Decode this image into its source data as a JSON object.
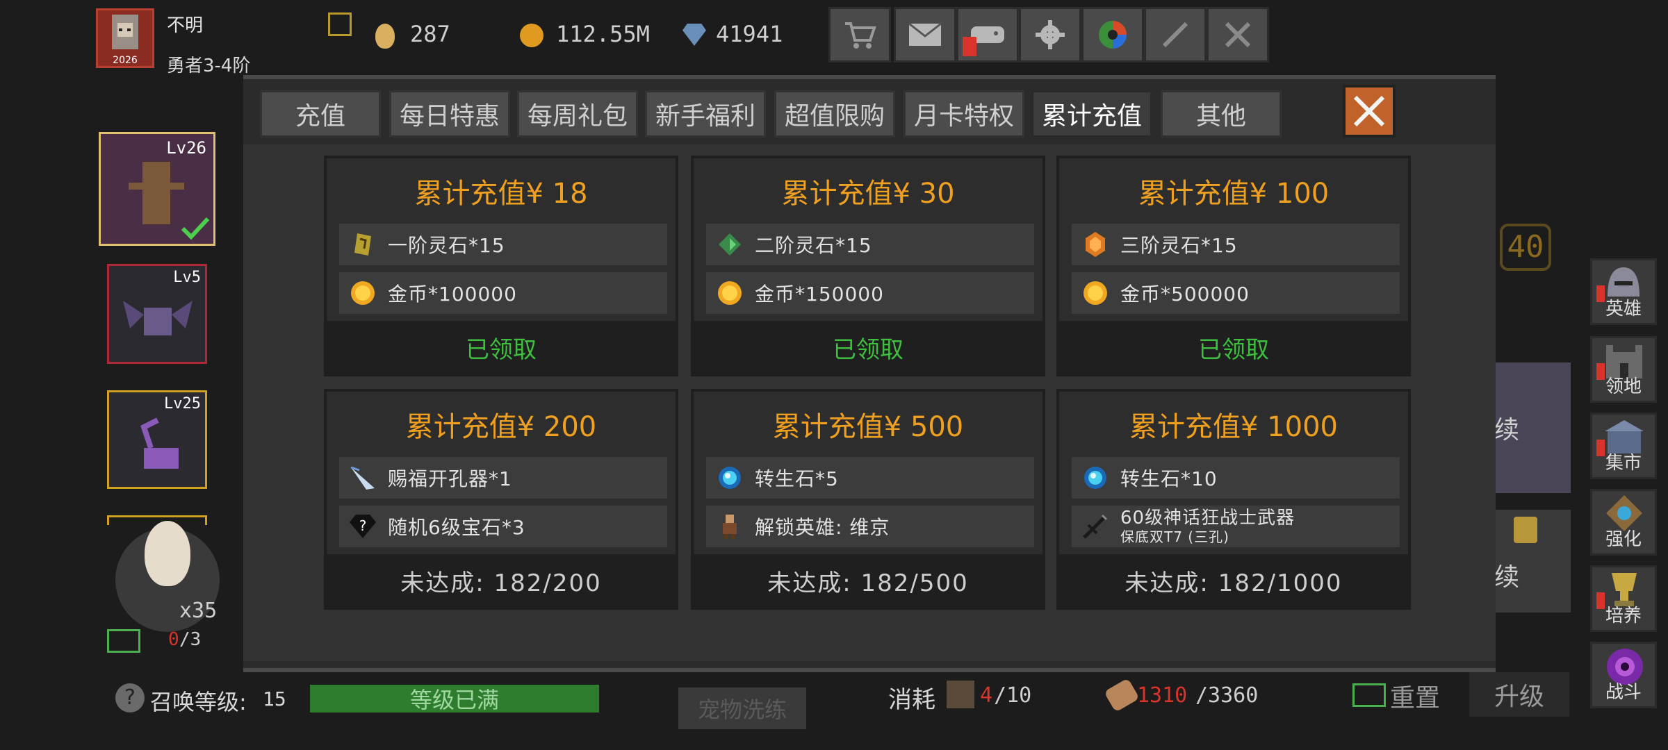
{
  "player": {
    "name": "不明",
    "rank": "勇者3-4阶",
    "avatar_year": "2026"
  },
  "resources": {
    "eggs": "287",
    "gold": "112.55M",
    "gems": "41941"
  },
  "top_icons": [
    "cart-icon",
    "mail-icon",
    "gamepad-icon",
    "gear-icon",
    "color-wheel-icon",
    "sword-locked-icon",
    "sword-crossed-icon"
  ],
  "tabs": [
    {
      "label": "充值"
    },
    {
      "label": "每日特惠"
    },
    {
      "label": "每周礼包"
    },
    {
      "label": "新手福利"
    },
    {
      "label": "超值限购"
    },
    {
      "label": "月卡特权"
    },
    {
      "label": "累计充值",
      "active": true
    },
    {
      "label": "其他"
    }
  ],
  "cards": [
    {
      "title": "累计充值¥ 18",
      "items": [
        {
          "icon": "tier1-stone-icon",
          "text": "一阶灵石*15"
        },
        {
          "icon": "gold-coin-icon",
          "text": "金币*100000"
        }
      ],
      "status": "已领取",
      "done": true
    },
    {
      "title": "累计充值¥ 30",
      "items": [
        {
          "icon": "tier2-stone-icon",
          "text": "二阶灵石*15"
        },
        {
          "icon": "gold-coin-icon",
          "text": "金币*150000"
        }
      ],
      "status": "已领取",
      "done": true
    },
    {
      "title": "累计充值¥ 100",
      "items": [
        {
          "icon": "tier3-stone-icon",
          "text": "三阶灵石*15"
        },
        {
          "icon": "gold-coin-icon",
          "text": "金币*500000"
        }
      ],
      "status": "已领取",
      "done": true
    },
    {
      "title": "累计充值¥ 200",
      "items": [
        {
          "icon": "drill-icon",
          "text": "赐福开孔器*1"
        },
        {
          "icon": "random-gem-icon",
          "text": "随机6级宝石*3"
        }
      ],
      "status": "未达成: 182/200",
      "done": false
    },
    {
      "title": "累计充值¥ 500",
      "items": [
        {
          "icon": "rebirth-stone-icon",
          "text": "转生石*5"
        },
        {
          "icon": "hero-unlock-icon",
          "text": "解锁英雄: 维京"
        }
      ],
      "status": "未达成: 182/500",
      "done": false
    },
    {
      "title": "累计充值¥ 1000",
      "items": [
        {
          "icon": "rebirth-stone-icon",
          "text": "转生石*10"
        },
        {
          "icon": "mythic-weapon-icon",
          "text": "60级神话狂战士武器",
          "subtext": "保底双T7 (三孔)"
        }
      ],
      "status": "未达成: 182/1000",
      "done": false
    }
  ],
  "hero_slots": [
    {
      "level": "Lv26"
    },
    {
      "level": "Lv5"
    },
    {
      "level": "Lv25"
    }
  ],
  "side_menu": [
    {
      "label": "英雄"
    },
    {
      "label": "领地"
    },
    {
      "label": "集市"
    },
    {
      "label": "强化"
    },
    {
      "label": "培养"
    },
    {
      "label": "战斗"
    }
  ],
  "egg": {
    "count": "x35",
    "ad_count": "0",
    "ad_max": "/3"
  },
  "summon": {
    "label": "召唤等级: ",
    "level": "15",
    "bar_text": "等级已满"
  },
  "pet_train": "宠物洗练",
  "consume": {
    "label": "消耗",
    "a_have": "4",
    "a_need": "/10",
    "b_have": "1310",
    "b_need": "/3360",
    "reset": "重置",
    "upgrade": "升级"
  },
  "bg_number": "40",
  "bg_continue": "续",
  "colors": {
    "accent_title": "#f0a020",
    "done": "#3fbf3f",
    "warn": "#d9342b",
    "bar_green": "#2e7d2e"
  }
}
